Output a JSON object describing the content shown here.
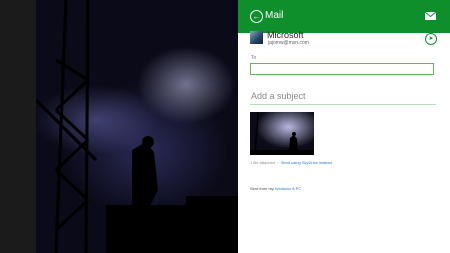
{
  "header": {
    "title": "Mail",
    "back_icon": "back-arrow-icon",
    "envelope_icon": "envelope-icon"
  },
  "account": {
    "name": "Microsoft",
    "email": "jajomw@msn.com"
  },
  "compose": {
    "to_label": "To",
    "subject_placeholder": "Add a subject",
    "send_icon": "send-icon"
  },
  "attachment": {
    "count_text": "1 file attached",
    "link_text": "Send using SkyDrive instead"
  },
  "signature": {
    "prefix": "Sent from my",
    "link": "Windows 8 PC"
  },
  "colors": {
    "accent": "#0f8e2c",
    "link": "#2b7bd0"
  }
}
